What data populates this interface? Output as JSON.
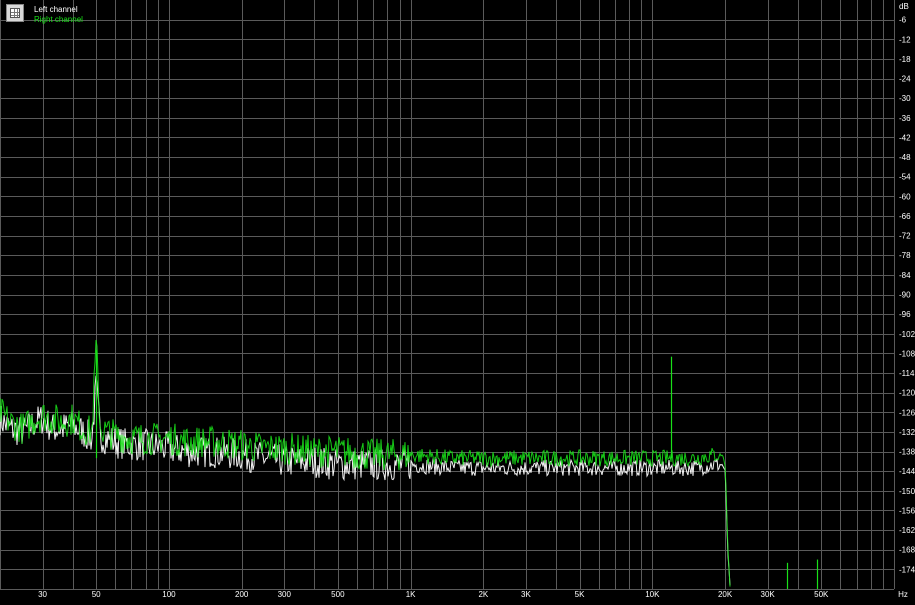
{
  "legend": {
    "left_label": "Left channel",
    "right_label": "Right channel"
  },
  "colors": {
    "background": "#000000",
    "grid": "#5a5a5a",
    "left_channel": "#ffffff",
    "right_channel": "#19e019",
    "text": "#ffffff"
  },
  "chart_data": {
    "type": "line",
    "title": "",
    "xlabel": "Hz",
    "ylabel": "dB",
    "x_scale": "log",
    "xlim": [
      20,
      100000
    ],
    "ylim": [
      -180,
      0
    ],
    "grid": true,
    "legend_position": "top-left",
    "x_ticks": [
      {
        "v": 30,
        "label": "30"
      },
      {
        "v": 50,
        "label": "50"
      },
      {
        "v": 100,
        "label": "100"
      },
      {
        "v": 200,
        "label": "200"
      },
      {
        "v": 300,
        "label": "300"
      },
      {
        "v": 500,
        "label": "500"
      },
      {
        "v": 1000,
        "label": "1K"
      },
      {
        "v": 2000,
        "label": "2K"
      },
      {
        "v": 3000,
        "label": "3K"
      },
      {
        "v": 5000,
        "label": "5K"
      },
      {
        "v": 10000,
        "label": "10K"
      },
      {
        "v": 20000,
        "label": "20K"
      },
      {
        "v": 30000,
        "label": "30K"
      },
      {
        "v": 50000,
        "label": "50K"
      }
    ],
    "x_unit_label": "Hz",
    "y_unit_label": "dB",
    "y_ticks": [
      -6,
      -12,
      -18,
      -24,
      -30,
      -36,
      -42,
      -48,
      -54,
      -60,
      -66,
      -72,
      -78,
      -84,
      -90,
      -96,
      -102,
      -108,
      -114,
      -120,
      -126,
      -132,
      -138,
      -144,
      -150,
      -156,
      -162,
      -168,
      -174
    ],
    "series": [
      {
        "name": "Left channel",
        "color": "#ffffff",
        "x": [
          20,
          22,
          25,
          28,
          30,
          33,
          36,
          40,
          44,
          48,
          50,
          52,
          55,
          60,
          70,
          80,
          100,
          120,
          150,
          200,
          250,
          300,
          400,
          500,
          700,
          1000,
          1500,
          2000,
          3000,
          5000,
          7000,
          10000,
          12000,
          15000,
          18000,
          19000,
          19500,
          20000,
          20200,
          20500,
          21000
        ],
        "y": [
          -128,
          -131,
          -132,
          -129,
          -128,
          -131,
          -131,
          -130,
          -132,
          -134,
          -118,
          -133,
          -134,
          -135,
          -136,
          -136,
          -137,
          -138,
          -138,
          -139,
          -140,
          -141,
          -141,
          -142,
          -142,
          -142,
          -143,
          -143,
          -143,
          -143,
          -143,
          -143,
          -143,
          -143,
          -142,
          -142,
          -142,
          -144,
          -152,
          -168,
          -180
        ]
      },
      {
        "name": "Right channel",
        "color": "#19e019",
        "x": [
          20,
          22,
          25,
          28,
          30,
          33,
          36,
          40,
          44,
          48,
          50,
          52,
          55,
          60,
          70,
          80,
          100,
          120,
          150,
          200,
          250,
          300,
          400,
          500,
          700,
          1000,
          1500,
          2000,
          3000,
          5000,
          7000,
          10000,
          12000,
          15000,
          18000,
          19000,
          19500,
          20000,
          20200,
          20500,
          21000
        ],
        "y": [
          -126,
          -129,
          -131,
          -128,
          -127,
          -128,
          -129,
          -128,
          -131,
          -132,
          -105,
          -131,
          -132,
          -133,
          -134,
          -134,
          -134,
          -135,
          -135,
          -136,
          -137,
          -137,
          -138,
          -138,
          -139,
          -139,
          -140,
          -140,
          -140,
          -140,
          -140,
          -140,
          -140,
          -140,
          -139,
          -139,
          -139,
          -142,
          -150,
          -166,
          -180
        ]
      }
    ],
    "spurs": [
      {
        "series": "Right channel",
        "x": 50,
        "y": -107
      },
      {
        "series": "Right channel",
        "x": 12000,
        "y": -109
      },
      {
        "series": "Right channel",
        "x": 36000,
        "y": -172
      },
      {
        "series": "Right channel",
        "x": 48000,
        "y": -171
      }
    ]
  }
}
